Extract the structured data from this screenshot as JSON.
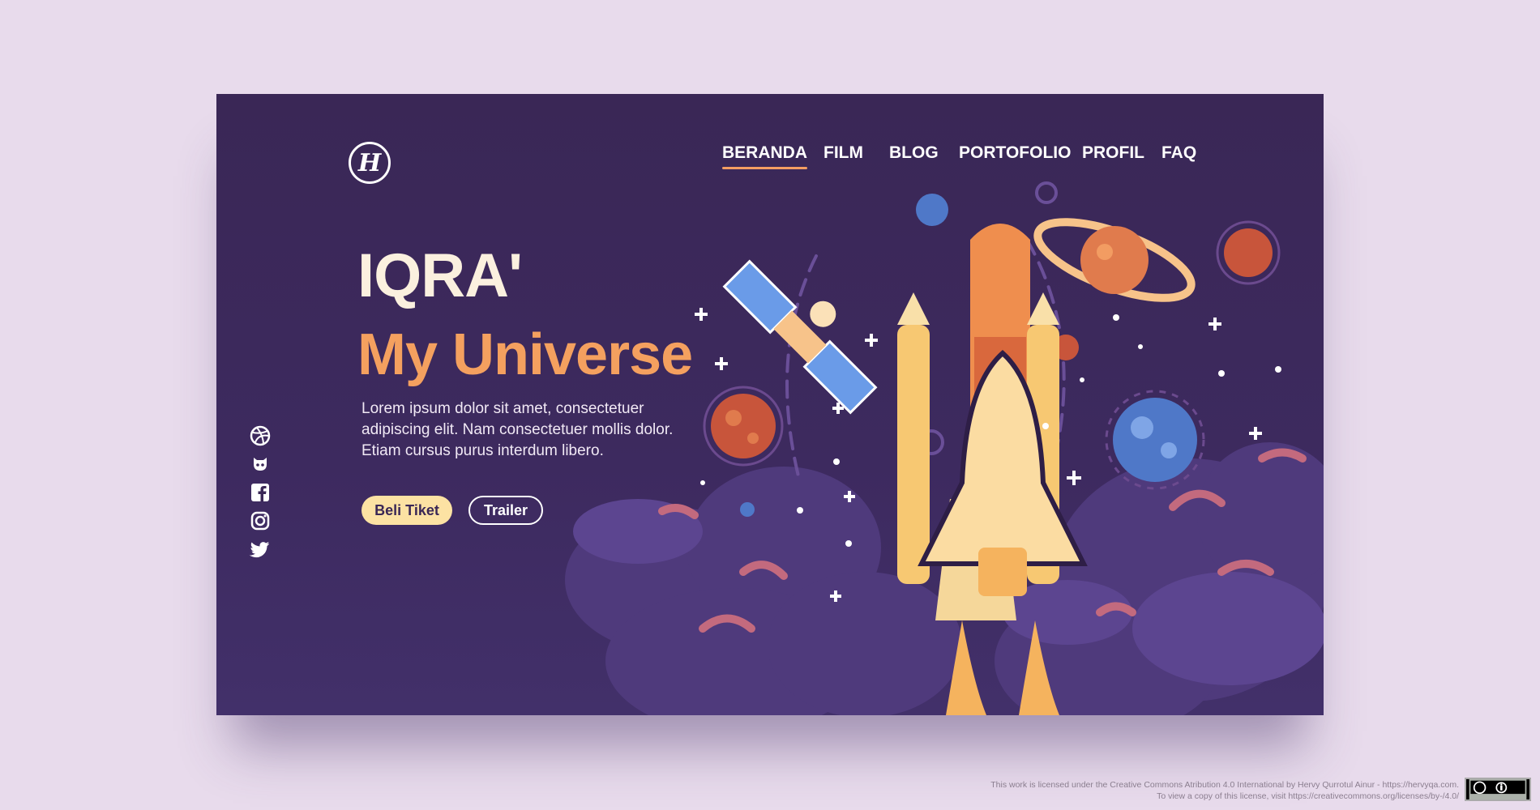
{
  "brand": {
    "logo_glyph": "H"
  },
  "nav": {
    "items": [
      {
        "label": "BERANDA",
        "active": true
      },
      {
        "label": "FILM",
        "active": false
      },
      {
        "label": "BLOG",
        "active": false
      },
      {
        "label": "PORTOFOLIO",
        "active": false
      },
      {
        "label": "PROFIL",
        "active": false
      },
      {
        "label": "FAQ",
        "active": false
      }
    ]
  },
  "hero": {
    "title": "IQRA'",
    "subtitle": "My Universe",
    "description": "Lorem ipsum dolor sit amet, consectetuer adipiscing elit. Nam consectetuer mollis dolor. Etiam cursus purus interdum libero.",
    "buy_button": "Beli Tiket",
    "trailer_button": "Trailer"
  },
  "social": [
    "dribbble-icon",
    "github-icon",
    "facebook-icon",
    "instagram-icon",
    "twitter-icon"
  ],
  "footer": {
    "line1": "This work is licensed under the Creative Commons Atribution 4.0 International by Hervy Qurrotul Ainur - https://hervyqa.com.",
    "line2": "To view a copy of this license, visit https://creativecommons.org/licenses/by-/4.0/"
  },
  "colors": {
    "background": "#e8dbec",
    "card": "#3a2756",
    "accent_orange": "#f4a05f",
    "cream": "#fbf0df",
    "button_yellow": "#fce2a3"
  }
}
